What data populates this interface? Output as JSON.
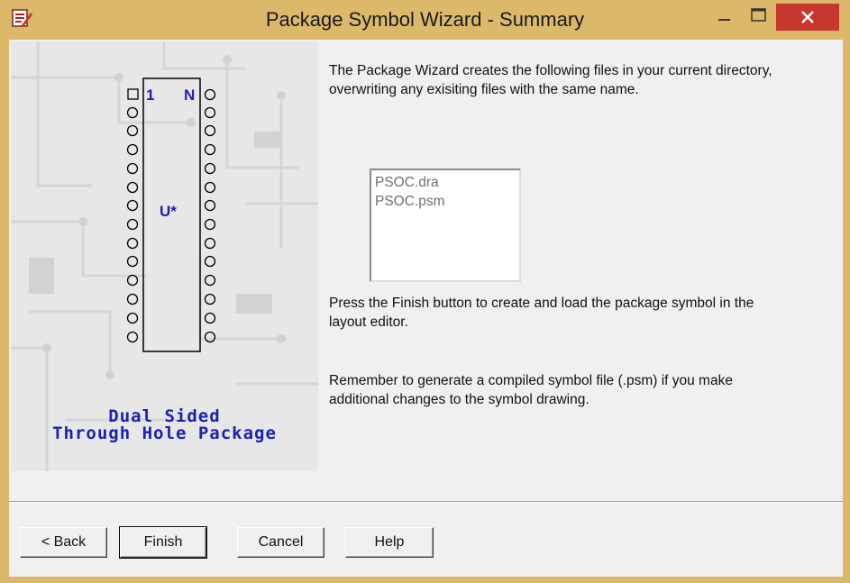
{
  "window": {
    "title": "Package Symbol Wizard - Summary",
    "icons": {
      "app": "wizard-app-icon",
      "minimize": "minimize-icon",
      "maximize": "maximize-icon",
      "close": "close-icon"
    },
    "accent": "#dcb96a",
    "close_color": "#c7372f"
  },
  "illustration": {
    "pin_first": "1",
    "pin_last": "N",
    "refdes": "U*",
    "caption_line1": "Dual Sided",
    "caption_line2": "Through Hole Package",
    "caption_color": "#1b22b3"
  },
  "summary": {
    "intro": "The Package Wizard creates the following files in your current directory, overwriting any exisiting files with the same name.",
    "files": [
      "PSOC.dra",
      "PSOC.psm"
    ],
    "finish_note": "Press the Finish button to create and load the package symbol in the layout editor.",
    "reminder": "Remember to generate a compiled symbol file (.psm) if you make additional changes to the symbol drawing."
  },
  "buttons": {
    "back": "< Back",
    "finish": "Finish",
    "cancel": "Cancel",
    "help": "Help"
  }
}
